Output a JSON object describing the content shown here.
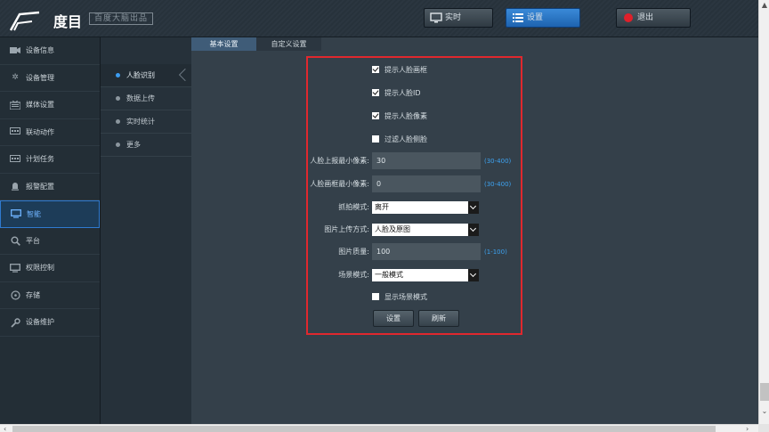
{
  "header": {
    "logo_text": "度目",
    "slogan": "百度大脑出品",
    "buttons": {
      "live": "实时",
      "settings": "设置",
      "logout": "退出"
    }
  },
  "sidebar": {
    "items": [
      {
        "label": "设备信息",
        "icon": "camera-icon"
      },
      {
        "label": "设备管理",
        "icon": "gear-icon"
      },
      {
        "label": "媒体设置",
        "icon": "media-icon"
      },
      {
        "label": "联动动作",
        "icon": "link-icon"
      },
      {
        "label": "计划任务",
        "icon": "calendar-icon"
      },
      {
        "label": "报警配置",
        "icon": "alarm-icon"
      },
      {
        "label": "智能",
        "icon": "monitor-icon"
      },
      {
        "label": "平台",
        "icon": "search-icon"
      },
      {
        "label": "权限控制",
        "icon": "monitor-icon"
      },
      {
        "label": "存储",
        "icon": "storage-icon"
      },
      {
        "label": "设备维护",
        "icon": "wrench-icon"
      }
    ],
    "active_index": 6
  },
  "subnav": {
    "items": [
      "人脸识别",
      "数据上传",
      "实时统计",
      "更多"
    ],
    "active_index": 0
  },
  "tabs": [
    "基本设置",
    "自定义设置"
  ],
  "form": {
    "checkboxes": [
      {
        "label": "提示人脸画框",
        "checked": true
      },
      {
        "label": "提示人脸ID",
        "checked": true
      },
      {
        "label": "提示人脸像素",
        "checked": true
      },
      {
        "label": "过滤人脸侧脸",
        "checked": false
      }
    ],
    "min_upload_pixels": {
      "label": "人脸上报最小像素:",
      "value": "30",
      "hint": "(30-400)"
    },
    "min_box_pixels": {
      "label": "人脸画框最小像素:",
      "value": "0",
      "hint": "(30-400)"
    },
    "capture_mode": {
      "label": "抓拍模式:",
      "value": "离开"
    },
    "upload_mode": {
      "label": "图片上传方式:",
      "value": "人脸及原图"
    },
    "image_quality": {
      "label": "图片质量:",
      "value": "100",
      "hint": "(1-100)"
    },
    "scene_mode": {
      "label": "场景模式:",
      "value": "一般模式"
    },
    "show_scene_mode": {
      "label": "显示场景模式",
      "checked": false
    },
    "buttons": {
      "set": "设置",
      "refresh": "刷新"
    }
  },
  "colors": {
    "accent": "#2f7ad0",
    "highlight_border": "#e0282e",
    "hint": "#3da2f0",
    "logout_dot": "#e0202a"
  }
}
